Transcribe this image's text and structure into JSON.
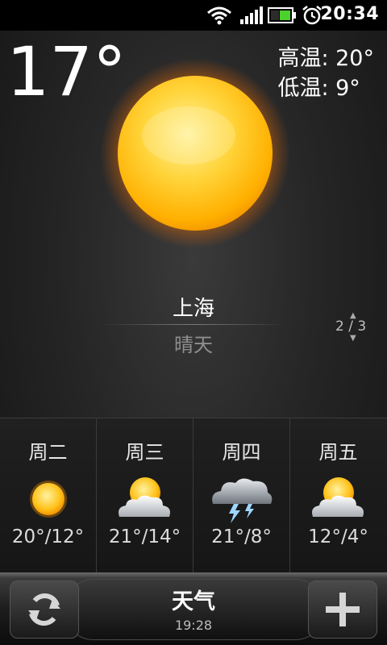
{
  "status_bar": {
    "time": "20:34",
    "icons": [
      "wifi-icon",
      "signal-icon",
      "battery-icon",
      "alarm-icon"
    ]
  },
  "current": {
    "temperature": "17°",
    "high": "高温: 20°",
    "low": "低温: 9°",
    "icon": "sun-icon",
    "city": "上海",
    "condition": "晴天",
    "page_indicator": "2 / 3"
  },
  "forecast": [
    {
      "day": "周二",
      "icon": "sunny-icon",
      "temps": "20°/12°"
    },
    {
      "day": "周三",
      "icon": "partly-cloudy-icon",
      "temps": "21°/14°"
    },
    {
      "day": "周四",
      "icon": "thunderstorm-icon",
      "temps": "21°/8°"
    },
    {
      "day": "周五",
      "icon": "partly-cloudy-icon",
      "temps": "12°/4°"
    }
  ],
  "bottom_bar": {
    "title": "天气",
    "updated_time": "19:28",
    "refresh_icon": "refresh-icon",
    "add_icon": "plus-icon"
  },
  "colors": {
    "background": "#262626",
    "sun": "#ffc21a",
    "condition_text": "#8f8f8f"
  }
}
